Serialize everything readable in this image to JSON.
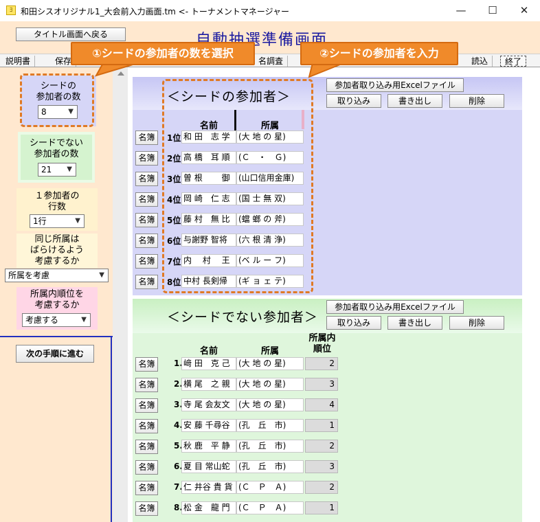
{
  "window": {
    "icon_glyph": "ﾖ",
    "title": "和田シスオリジナル1_大会前入力画面.tm <- トーナメントマネージャー",
    "minimize": "—",
    "maximize": "☐",
    "close": "✕"
  },
  "header": {
    "back_button": "タイトル画面へ戻る",
    "page_title": "自動抽選準備画面"
  },
  "menubar": {
    "items": [
      "説明書",
      "保存",
      "名調査",
      "読込",
      "終了"
    ]
  },
  "callouts": {
    "select_count": "①シードの参加者の数を選択",
    "enter_seeds": "②シードの参加者を入力"
  },
  "left_panel": {
    "seed_count_label": "シードの\n参加者の数",
    "seed_count_value": "8",
    "nonseed_count_label": "シードでない\n参加者の数",
    "nonseed_count_value": "21",
    "rows_label": "１参加者の\n行数",
    "rows_value": "1行",
    "separate_label": "同じ所属は\nばらけるよう\n考慮するか",
    "separate_value": "所属を考慮",
    "order_label": "所属内順位を\n考慮するか",
    "order_value": "考慮する",
    "next_button": "次の手順に進む"
  },
  "seed_section": {
    "heading": "＜シードの参加者＞",
    "excel_button": "参加者取り込み用Excelファイル",
    "import_button": "取り込み",
    "export_button": "書き出し",
    "delete_button": "削除",
    "col_name": "名前",
    "col_affiliation": "所属",
    "meibo_label": "名簿",
    "rows": [
      {
        "rank": "1位",
        "name": "和 田　志 学",
        "affiliation": "(大 地 の 星)"
      },
      {
        "rank": "2位",
        "name": "高 橋　耳 順",
        "affiliation": "(Ｃ　・　Ｇ)"
      },
      {
        "rank": "3位",
        "name": "曽 根　　 御",
        "affiliation": "(山口信用金庫)"
      },
      {
        "rank": "4位",
        "name": "岡 崎　仁 志",
        "affiliation": "(国 士 無 双)"
      },
      {
        "rank": "5位",
        "name": "藤 村　無 比",
        "affiliation": "(蟷 螂 の 斧)"
      },
      {
        "rank": "6位",
        "name": "与謝野 智将",
        "affiliation": "(六 根 清 浄)"
      },
      {
        "rank": "7位",
        "name": "内 　村　 王",
        "affiliation": "(ベ ル ー フ)"
      },
      {
        "rank": "8位",
        "name": "中村 長剣帰",
        "affiliation": "(ギ ョ ェ テ)"
      }
    ]
  },
  "nonseed_section": {
    "heading": "＜シードでない参加者＞",
    "excel_button": "参加者取り込み用Excelファイル",
    "import_button": "取り込み",
    "export_button": "書き出し",
    "delete_button": "削除",
    "col_name": "名前",
    "col_affiliation": "所属",
    "col_order": "所属内\n順位",
    "meibo_label": "名簿",
    "rows": [
      {
        "rank": "1.",
        "name": "﨑 田　克 己",
        "affiliation": "(大 地 の 星)",
        "order": "2"
      },
      {
        "rank": "2.",
        "name": "横 尾　之 親",
        "affiliation": "(大 地 の 星)",
        "order": "3"
      },
      {
        "rank": "3.",
        "name": "寺 尾 会友文",
        "affiliation": "(大 地 の 星)",
        "order": "4"
      },
      {
        "rank": "4.",
        "name": "安 藤 千尋谷",
        "affiliation": "(孔　丘　市)",
        "order": "1"
      },
      {
        "rank": "5.",
        "name": "秋 鹿　平 静",
        "affiliation": "(孔　丘　市)",
        "order": "2"
      },
      {
        "rank": "6.",
        "name": "夏 目 常山蛇",
        "affiliation": "(孔　丘　市)",
        "order": "3"
      },
      {
        "rank": "7.",
        "name": "仁 井谷 貴 貨",
        "affiliation": "(Ｃ　Ｐ　Ａ)",
        "order": "2"
      },
      {
        "rank": "8.",
        "name": "松 金　龍 門",
        "affiliation": "(Ｃ　Ｐ　Ａ)",
        "order": "1"
      }
    ]
  },
  "colors": {
    "accent_orange": "#f08a2a",
    "seed_bg": "#d6d6f7",
    "nonseed_bg": "#dff6dc",
    "left_panel_bg": "#ffe8cf"
  }
}
